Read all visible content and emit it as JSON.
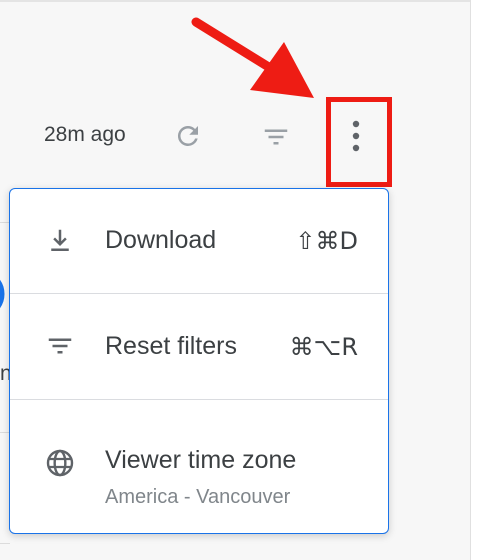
{
  "toolbar": {
    "last_updated": "28m ago",
    "refresh_icon": "refresh-icon",
    "filter_icon": "filter-icon",
    "more_icon": "more-vert-icon"
  },
  "annotation": {
    "arrow_color": "#ee1c14",
    "highlight_color": "#ee1c14"
  },
  "background_fragment": {
    "text": "n"
  },
  "menu": {
    "border_color": "#1a73e8",
    "items": [
      {
        "label": "Download",
        "shortcut": "⇧⌘D",
        "icon": "download-icon"
      },
      {
        "label": "Reset filters",
        "shortcut": "⌘⌥R",
        "icon": "filter-icon"
      },
      {
        "label": "Viewer time zone",
        "sublabel": "America - Vancouver",
        "icon": "globe-icon"
      }
    ]
  }
}
